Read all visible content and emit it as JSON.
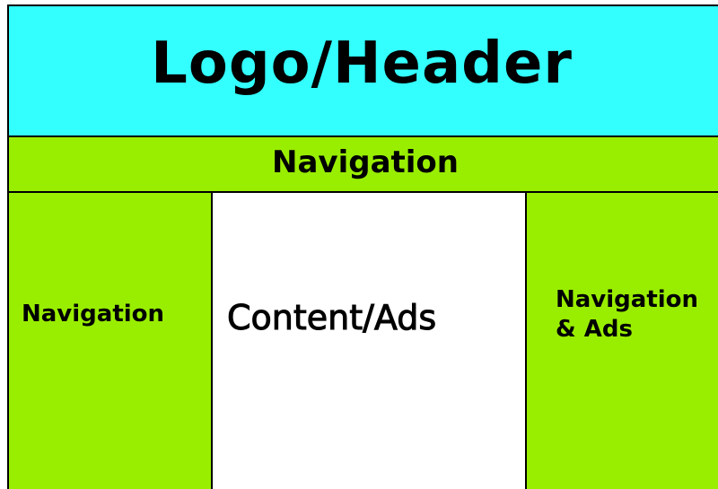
{
  "colors": {
    "header_bg": "#33ffff",
    "nav_bg": "#99ee00",
    "content_bg": "#ffffff",
    "border": "#000000",
    "text": "#000000"
  },
  "header": {
    "label": "Logo/Header"
  },
  "top_nav": {
    "label": "Navigation"
  },
  "left_nav": {
    "label": "Navigation"
  },
  "content": {
    "label": "Content/Ads"
  },
  "right_nav": {
    "line1": "Navigation",
    "line2": "& Ads"
  }
}
